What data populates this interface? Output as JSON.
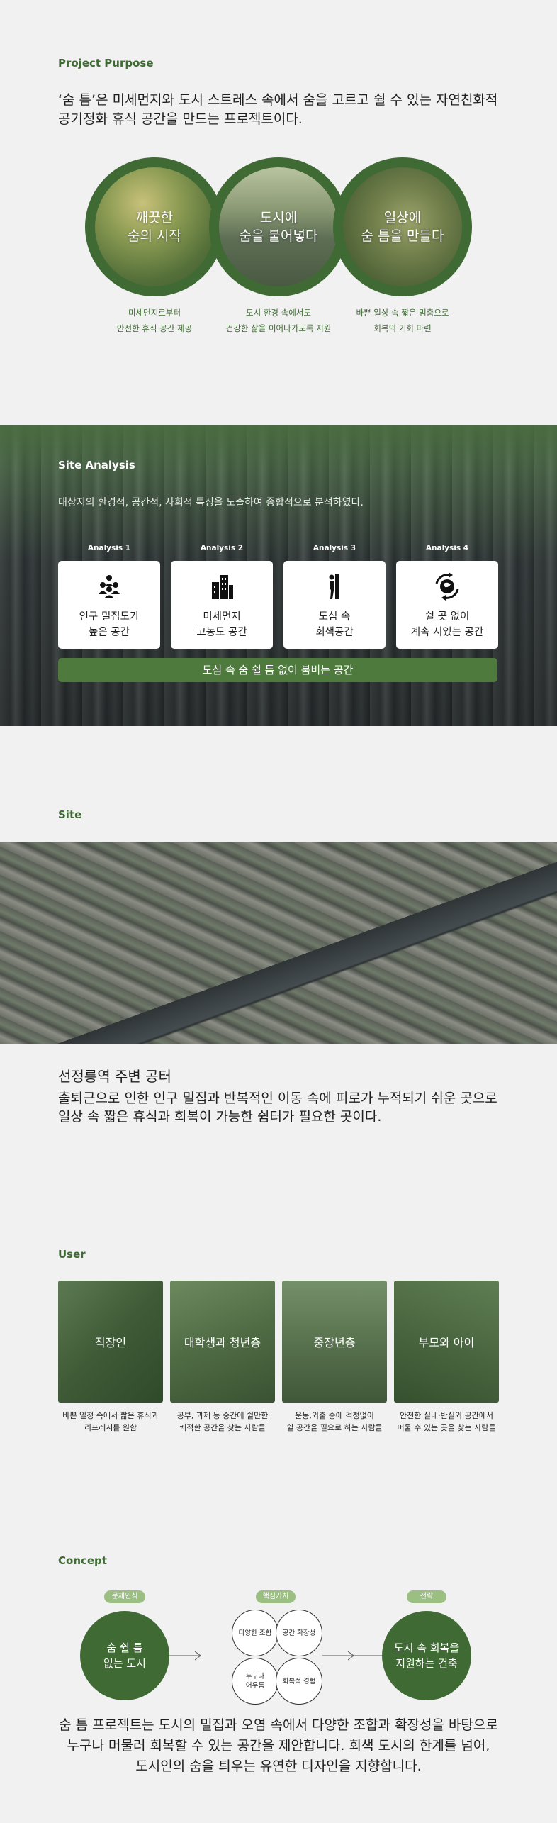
{
  "purpose": {
    "label": "Project Purpose",
    "text": "‘숨 틈’은 미세먼지와 도시 스트레스 속에서 숨을 고르고 쉴 수 있는 자연친화적 공기정화 휴식 공간을 만드는 프로젝트이다.",
    "circles": [
      {
        "title": "깨끗한\n숨의 시작",
        "caption": "미세먼지로부터\n안전한 휴식 공간 제공"
      },
      {
        "title": "도시에\n숨을 불어넣다",
        "caption": "도시 환경 속에서도\n건강한 삶을 이어나가도록 지원"
      },
      {
        "title": "일상에\n숨 틈을 만들다",
        "caption": "바쁜 일상 속 짧은 멈춤으로\n회복의 기회 마련"
      }
    ]
  },
  "analysis": {
    "label": "Site Analysis",
    "description": "대상지의 환경적, 공간적, 사회적 특징을 도출하여 종합적으로 분석하였다.",
    "cards": [
      {
        "label": "Analysis 1",
        "text": "인구 밀집도가\n높은 공간",
        "icon": "people-group-icon"
      },
      {
        "label": "Analysis 2",
        "text": "미세먼지\n고농도 공간",
        "icon": "buildings-icon"
      },
      {
        "label": "Analysis 3",
        "text": "도심 속\n회색공간",
        "icon": "person-wall-icon"
      },
      {
        "label": "Analysis 4",
        "text": "쉴 곳 없이\n계속 서있는 공간",
        "icon": "globe-arrows-icon"
      }
    ],
    "summary": "도심 속 숨 쉴 틈 없이 붐비는 공간"
  },
  "site": {
    "label": "Site",
    "title": "선정릉역 주변 공터",
    "description": "출퇴근으로 인한 인구 밀집과 반복적인 이동 속에 피로가 누적되기 쉬운 곳으로\n일상 속 짧은 휴식과 회복이 가능한 쉼터가 필요한 곳이다."
  },
  "user": {
    "label": "User",
    "groups": [
      {
        "title": "직장인",
        "description": "바쁜 일정 속에서 짧은 휴식과\n리프레시를 원함"
      },
      {
        "title": "대학생과 청년층",
        "description": "공부, 과제 등 중간에 쉴만한\n쾌적한 공간을 찾는 사람들"
      },
      {
        "title": "중장년층",
        "description": "운동,외출 중에 걱정없이\n쉴 공간을 필요로 하는 사람들"
      },
      {
        "title": "부모와 아이",
        "description": "안전한 실내·반실외 공간에서\n머물 수 있는 곳을 찾는 사람들"
      }
    ]
  },
  "concept": {
    "label": "Concept",
    "tags": [
      "문제인식",
      "핵심가치",
      "전략"
    ],
    "problem": "숨 쉴 틈\n없는 도시",
    "values": [
      "다양한 조합",
      "공간 확장성",
      "누구나\n어우름",
      "회복적 경험"
    ],
    "strategy": "도시 속 회복을\n지원하는 건축",
    "text": "숨 틈 프로젝트는 도시의 밀집과 오염 속에서 다양한 조합과 확장성을 바탕으로\n누구나 머물러 회복할 수 있는 공간을 제안합니다. 회색 도시의 한계를 넘어,\n도시인의 숨을 틔우는 유연한 디자인을 지향합니다."
  },
  "colors": {
    "accent": "#3f6a34",
    "background": "#f1f1f1",
    "pill": "#9bbf83"
  }
}
